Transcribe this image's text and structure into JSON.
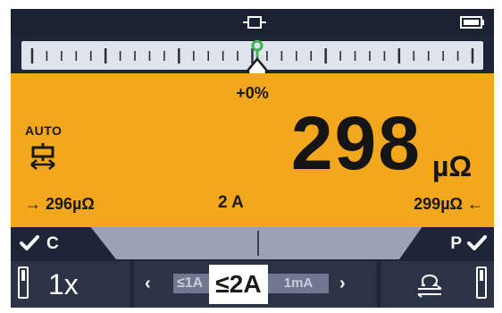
{
  "status_bar": {
    "icons": [
      "probe-connection-icon",
      "battery-icon"
    ]
  },
  "deviation_scale": {
    "deviation_label": "+0%",
    "pointer_position_fraction": 0.5
  },
  "measurement": {
    "mode_label": "AUTO",
    "mode_icon": "auto-probe-icon",
    "value": "298",
    "unit": "µΩ",
    "min_value": "→ 296µΩ",
    "test_current": "2 A",
    "max_value": "299µΩ ←"
  },
  "limits": {
    "left_label": "C",
    "right_label": "P",
    "left_icon": "check-icon",
    "right_icon": "check-icon"
  },
  "softkeys": {
    "multiplier": "1x",
    "current_options": {
      "previous": "≤1A",
      "selected": "≤2A",
      "next": "1mA"
    },
    "reverse_icon": "current-reversal-icon"
  },
  "colors": {
    "background": "#1e2536",
    "reading_panel": "#f2a71d",
    "scale": "#dfe3ec",
    "pointer_indicator": "#39b54a",
    "strip": "#9aa3b5"
  }
}
